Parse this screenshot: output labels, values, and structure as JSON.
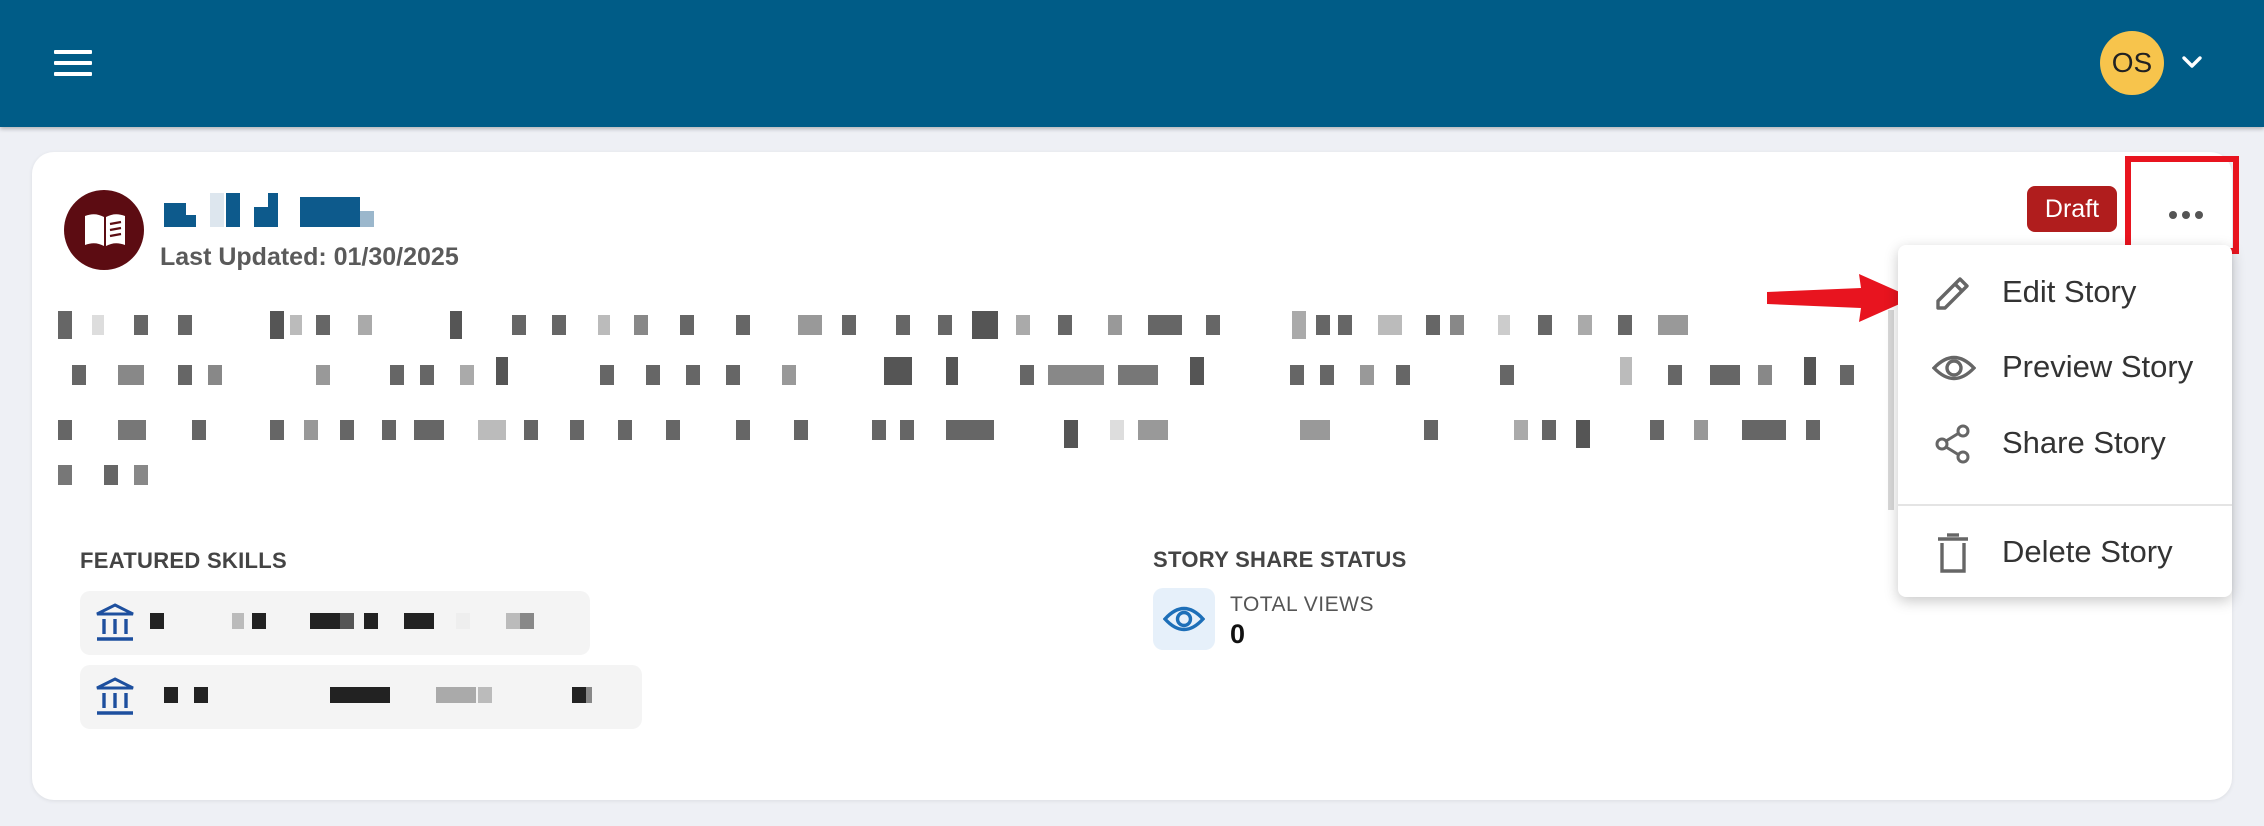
{
  "header": {
    "menu_icon": "hamburger-menu-icon",
    "avatar_initials": "OS",
    "avatar_chevron_icon": "chevron-down-icon",
    "bar_color": "#005c87",
    "avatar_color": "#f7c44c"
  },
  "story": {
    "icon": "book-icon",
    "last_updated": "Last Updated: 01/30/2025",
    "status_badge": "Draft",
    "status_color": "#b01d1d",
    "more_icon": "more-horizontal-icon"
  },
  "featured_skills": {
    "heading": "FEATURED SKILLS",
    "skill_icon": "institution-icon"
  },
  "share_status": {
    "heading": "STORY SHARE STATUS",
    "views_icon": "eye-icon",
    "total_views_label": "TOTAL VIEWS",
    "total_views_value": "0"
  },
  "menu": {
    "items": [
      {
        "label": "Edit Story",
        "icon": "pencil-icon"
      },
      {
        "label": "Preview Story",
        "icon": "eye-icon"
      },
      {
        "label": "Share Story",
        "icon": "share-icon"
      },
      {
        "label": "Delete Story",
        "icon": "trash-icon"
      }
    ]
  },
  "annotations": {
    "highlight_color": "#e8141f",
    "arrow_color": "#e8141f"
  }
}
